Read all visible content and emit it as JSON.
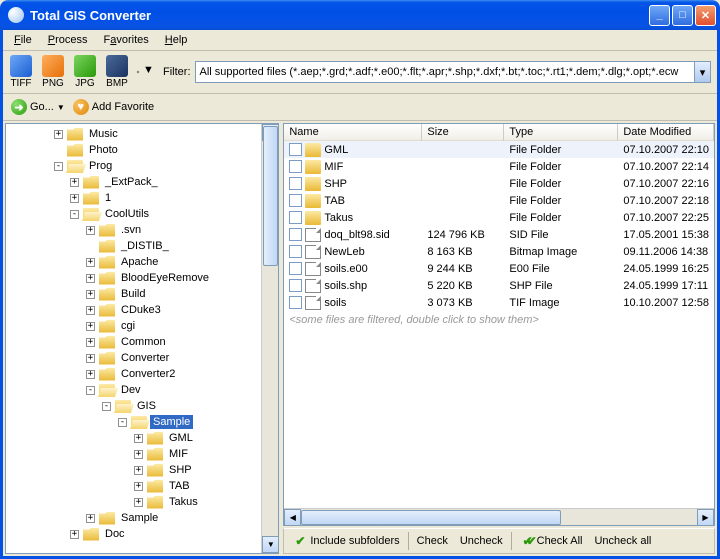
{
  "window": {
    "title": "Total GIS Converter"
  },
  "menu": {
    "file": "File",
    "process": "Process",
    "favorites": "Favorites",
    "help": "Help"
  },
  "formats": {
    "tiff": "TIFF",
    "png": "PNG",
    "jpg": "JPG",
    "bmp": "BMP"
  },
  "filter": {
    "label": "Filter:",
    "value": "All supported files (*.aep;*.grd;*.adf;*.e00;*.flt;*.apr;*.shp;*.dxf;*.bt;*.toc;*.rt1;*.dem;*.dlg;*.opt;*.ecw"
  },
  "toolbar2": {
    "go": "Go...",
    "addfav": "Add Favorite"
  },
  "tree": [
    {
      "d": 3,
      "t": "+",
      "o": false,
      "label": "Music"
    },
    {
      "d": 3,
      "t": " ",
      "o": false,
      "label": "Photo"
    },
    {
      "d": 3,
      "t": "-",
      "o": true,
      "label": "Prog"
    },
    {
      "d": 4,
      "t": "+",
      "o": false,
      "label": "_ExtPack_"
    },
    {
      "d": 4,
      "t": "+",
      "o": false,
      "label": "1"
    },
    {
      "d": 4,
      "t": "-",
      "o": true,
      "label": "CoolUtils"
    },
    {
      "d": 5,
      "t": "+",
      "o": false,
      "label": ".svn"
    },
    {
      "d": 5,
      "t": " ",
      "o": false,
      "label": "_DISTIB_"
    },
    {
      "d": 5,
      "t": "+",
      "o": false,
      "label": "Apache"
    },
    {
      "d": 5,
      "t": "+",
      "o": false,
      "label": "BloodEyeRemove"
    },
    {
      "d": 5,
      "t": "+",
      "o": false,
      "label": "Build"
    },
    {
      "d": 5,
      "t": "+",
      "o": false,
      "label": "CDuke3"
    },
    {
      "d": 5,
      "t": "+",
      "o": false,
      "label": "cgi"
    },
    {
      "d": 5,
      "t": "+",
      "o": false,
      "label": "Common"
    },
    {
      "d": 5,
      "t": "+",
      "o": false,
      "label": "Converter"
    },
    {
      "d": 5,
      "t": "+",
      "o": false,
      "label": "Converter2"
    },
    {
      "d": 5,
      "t": "-",
      "o": true,
      "label": "Dev"
    },
    {
      "d": 6,
      "t": "-",
      "o": true,
      "label": "GIS"
    },
    {
      "d": 7,
      "t": "-",
      "o": true,
      "label": "Sample",
      "sel": true
    },
    {
      "d": 8,
      "t": "+",
      "o": false,
      "label": "GML"
    },
    {
      "d": 8,
      "t": "+",
      "o": false,
      "label": "MIF"
    },
    {
      "d": 8,
      "t": "+",
      "o": false,
      "label": "SHP"
    },
    {
      "d": 8,
      "t": "+",
      "o": false,
      "label": "TAB"
    },
    {
      "d": 8,
      "t": "+",
      "o": false,
      "label": "Takus"
    },
    {
      "d": 5,
      "t": "+",
      "o": false,
      "label": "Sample"
    },
    {
      "d": 4,
      "t": "+",
      "o": false,
      "label": "Doc"
    }
  ],
  "columns": {
    "name": "Name",
    "size": "Size",
    "type": "Type",
    "date": "Date Modified"
  },
  "files": [
    {
      "kind": "folder",
      "name": "GML",
      "size": "",
      "type": "File Folder",
      "date": "07.10.2007 22:10",
      "sel": true
    },
    {
      "kind": "folder",
      "name": "MIF",
      "size": "",
      "type": "File Folder",
      "date": "07.10.2007 22:14"
    },
    {
      "kind": "folder",
      "name": "SHP",
      "size": "",
      "type": "File Folder",
      "date": "07.10.2007 22:16"
    },
    {
      "kind": "folder",
      "name": "TAB",
      "size": "",
      "type": "File Folder",
      "date": "07.10.2007 22:18"
    },
    {
      "kind": "folder",
      "name": "Takus",
      "size": "",
      "type": "File Folder",
      "date": "07.10.2007 22:25"
    },
    {
      "kind": "file",
      "name": "doq_blt98.sid",
      "size": "124 796 KB",
      "type": "SID File",
      "date": "17.05.2001 15:38"
    },
    {
      "kind": "file",
      "name": "NewLeb",
      "size": "8 163 KB",
      "type": "Bitmap Image",
      "date": "09.11.2006 14:38"
    },
    {
      "kind": "file",
      "name": "soils.e00",
      "size": "9 244 KB",
      "type": "E00 File",
      "date": "24.05.1999 16:25"
    },
    {
      "kind": "file",
      "name": "soils.shp",
      "size": "5 220 KB",
      "type": "SHP File",
      "date": "24.05.1999 17:11"
    },
    {
      "kind": "file",
      "name": "soils",
      "size": "3 073 KB",
      "type": "TIF Image",
      "date": "10.10.2007 12:58"
    }
  ],
  "filterHint": "<some files are filtered, double click to show them>",
  "bottom": {
    "include": "Include subfolders",
    "check": "Check",
    "uncheck": "Uncheck",
    "checkall": "Check All",
    "uncheckall": "Uncheck all"
  }
}
